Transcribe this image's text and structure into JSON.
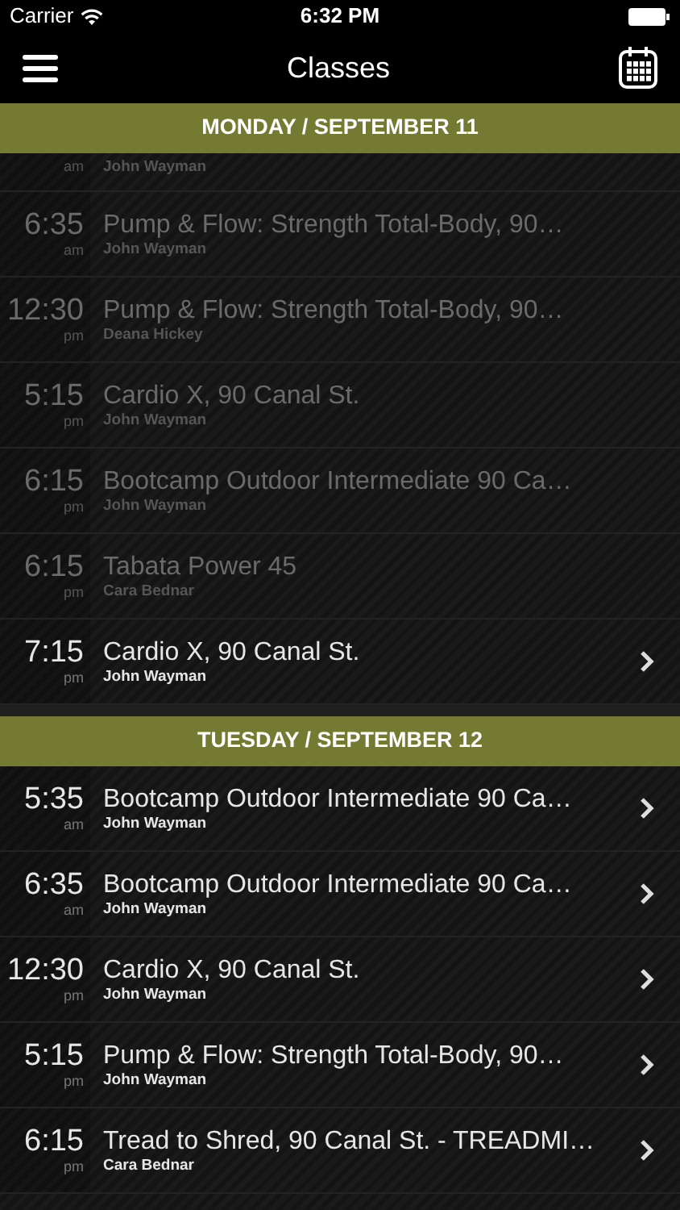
{
  "status_bar": {
    "carrier": "Carrier",
    "time": "6:32 PM"
  },
  "nav": {
    "title": "Classes"
  },
  "sections": [
    {
      "header": "MONDAY / SEPTEMBER 11",
      "classes": [
        {
          "period": "am",
          "instructor": "John Wayman",
          "disabled": true
        },
        {
          "time": "6:35",
          "period": "am",
          "title": "Pump & Flow: Strength Total-Body, 90…",
          "instructor": "John Wayman",
          "disabled": true
        },
        {
          "time": "12:30",
          "period": "pm",
          "title": "Pump & Flow: Strength Total-Body, 90…",
          "instructor": "Deana Hickey",
          "disabled": true
        },
        {
          "time": "5:15",
          "period": "pm",
          "title": "Cardio X, 90 Canal St.",
          "instructor": "John Wayman",
          "disabled": true
        },
        {
          "time": "6:15",
          "period": "pm",
          "title": "Bootcamp Outdoor Intermediate 90 Ca…",
          "instructor": "John Wayman",
          "disabled": true
        },
        {
          "time": "6:15",
          "period": "pm",
          "title": "Tabata Power 45",
          "instructor": "Cara Bednar",
          "disabled": true
        },
        {
          "time": "7:15",
          "period": "pm",
          "title": "Cardio X, 90 Canal St.",
          "instructor": "John Wayman",
          "disabled": false
        }
      ]
    },
    {
      "header": "TUESDAY / SEPTEMBER 12",
      "classes": [
        {
          "time": "5:35",
          "period": "am",
          "title": "Bootcamp Outdoor Intermediate 90 Ca…",
          "instructor": "John Wayman",
          "disabled": false
        },
        {
          "time": "6:35",
          "period": "am",
          "title": "Bootcamp Outdoor Intermediate 90 Ca…",
          "instructor": "John Wayman",
          "disabled": false
        },
        {
          "time": "12:30",
          "period": "pm",
          "title": "Cardio X, 90 Canal St.",
          "instructor": "John Wayman",
          "disabled": false
        },
        {
          "time": "5:15",
          "period": "pm",
          "title": "Pump & Flow: Strength Total-Body, 90…",
          "instructor": "John Wayman",
          "disabled": false
        },
        {
          "time": "6:15",
          "period": "pm",
          "title": "Tread to Shred, 90 Canal St. - TREADMI…",
          "instructor": "Cara Bednar",
          "disabled": false
        }
      ]
    }
  ]
}
